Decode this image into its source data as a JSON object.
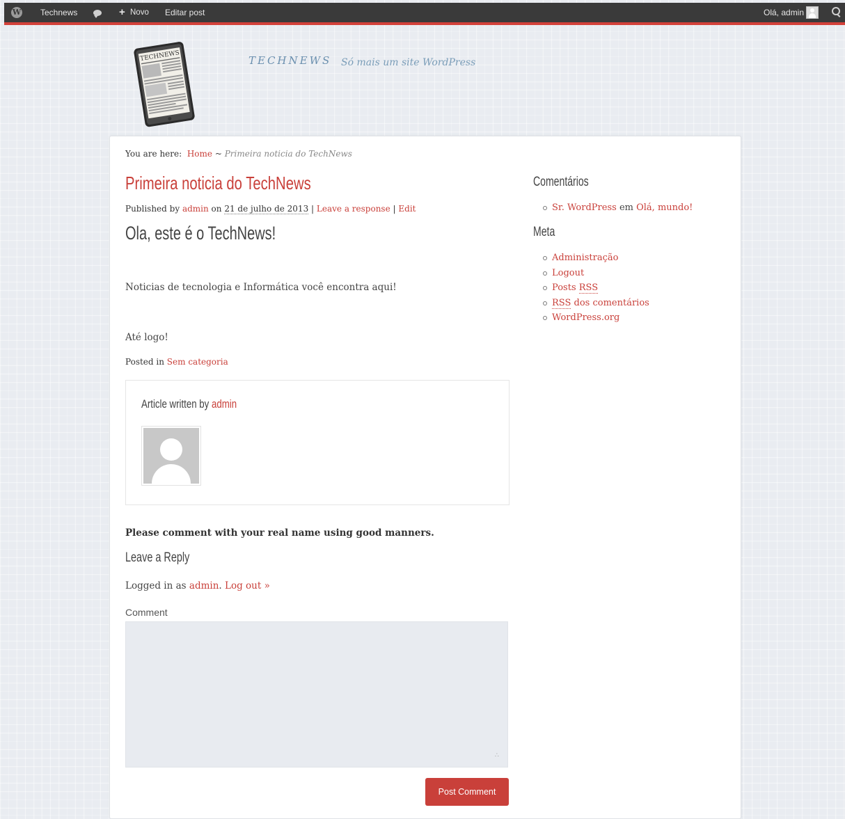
{
  "adminbar": {
    "site_name": "Technews",
    "new_label": "Novo",
    "edit_post": "Editar post",
    "greeting": "Olá, admin",
    "wp_logo_letter": "W",
    "plus": "+"
  },
  "header": {
    "site_title": "TECHNEWS",
    "tablet_text": "TECHNEWS",
    "tagline": "Só mais um site WordPress"
  },
  "breadcrumb": {
    "prefix": "You are here:",
    "home": "Home",
    "separator": "~",
    "current": "Primeira noticia do TechNews"
  },
  "post": {
    "title": "Primeira noticia do TechNews",
    "meta": {
      "published_by": "Published by",
      "author": "admin",
      "on": "on",
      "date": "21 de julho de 2013",
      "sep1": "|",
      "leave_response": "Leave a response",
      "sep2": "|",
      "edit": "Edit"
    },
    "heading": "Ola, este é o TechNews!",
    "paragraph1": "Noticias de tecnologia e Informática você encontra aqui!",
    "paragraph2": "Até logo!",
    "posted_in_label": "Posted in",
    "category": "Sem categoria"
  },
  "author_box": {
    "label": "Article written by",
    "author": "admin"
  },
  "comments": {
    "note": "Please comment with your real name using good manners.",
    "reply_title": "Leave a Reply",
    "logged_in_prefix": "Logged in as",
    "logged_in_user": "admin",
    "logout": "Log out »",
    "comment_label": "Comment",
    "comment_value": "",
    "submit_label": "Post Comment"
  },
  "sidebar": {
    "comments_title": "Comentários",
    "recent_comment": {
      "author": "Sr. WordPress",
      "em": "em",
      "post": "Olá, mundo!"
    },
    "meta_title": "Meta",
    "meta_links": {
      "admin": "Administração",
      "logout": "Logout",
      "posts": "Posts",
      "rss": "RSS",
      "rss2": "RSS",
      "comments_rss_rest": "dos comentários",
      "wordpress_org": "WordPress.org"
    }
  },
  "colors": {
    "accent": "#c9403a",
    "adminbar": "#3a3a3a",
    "page_bg": "#e9ecf1"
  }
}
